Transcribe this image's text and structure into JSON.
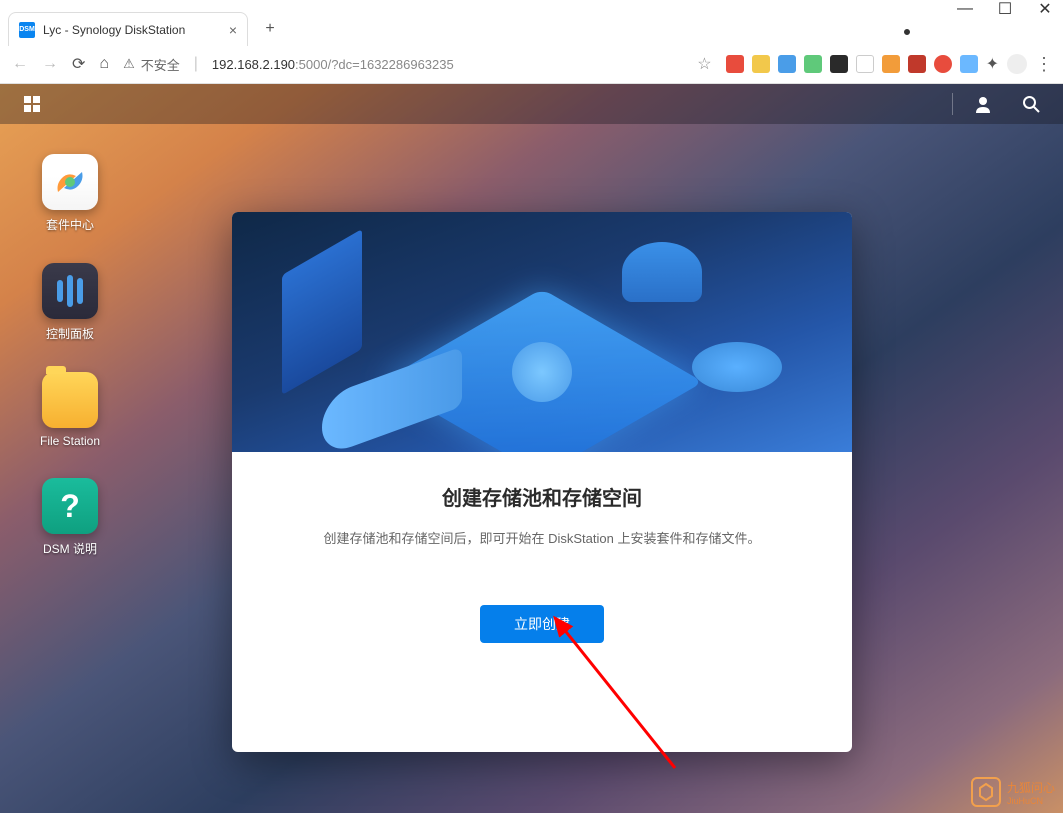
{
  "browser": {
    "tab_title": "Lyc - Synology DiskStation",
    "tab_favicon_text": "DSM",
    "security_label": "不安全",
    "url_host": "192.168.2.190",
    "url_port_path": ":5000/?dc=1632286963235"
  },
  "desktop": {
    "icons": [
      {
        "label": "套件中心"
      },
      {
        "label": "控制面板"
      },
      {
        "label": "File Station"
      },
      {
        "label": "DSM 说明"
      }
    ]
  },
  "dialog": {
    "title": "创建存储池和存储空间",
    "description": "创建存储池和存储空间后，即可开始在 DiskStation 上安装套件和存储文件。",
    "button": "立即创建"
  },
  "watermark": {
    "text_cn": "九狐问心",
    "text_en": "JiuHuCN"
  }
}
